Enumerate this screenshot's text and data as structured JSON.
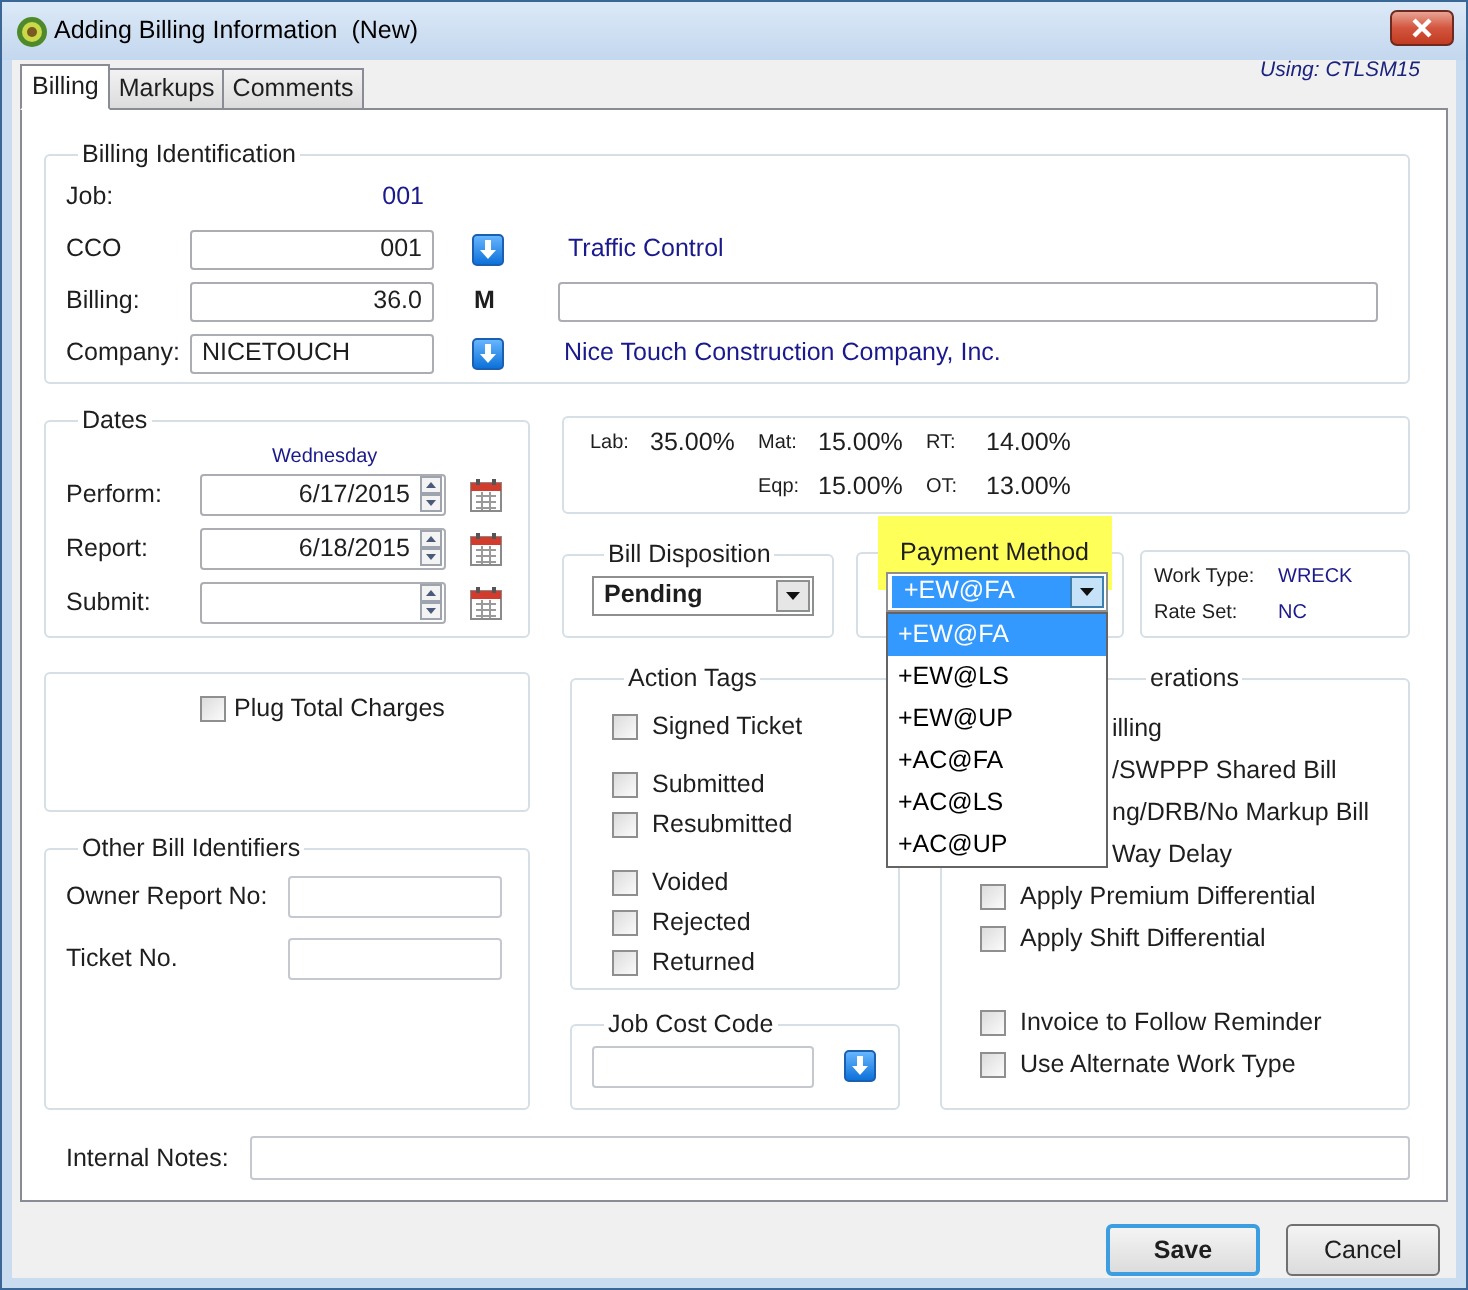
{
  "window": {
    "title": "Adding Billing Information  (New)"
  },
  "tabs": [
    {
      "label": "Billing",
      "selected": true
    },
    {
      "label": "Markups",
      "selected": false
    },
    {
      "label": "Comments",
      "selected": false
    }
  ],
  "using": "Using: CTLSM15",
  "billing_identification": {
    "title": "Billing Identification",
    "job_label": "Job:",
    "job_value": "001",
    "cco_label": "CCO",
    "cco_value": "001",
    "cco_name": "Traffic Control",
    "billing_label": "Billing:",
    "billing_value": "36.0",
    "billing_flag": "M",
    "company_label": "Company:",
    "company_value": "NICETOUCH",
    "company_name": "Nice Touch Construction Company, Inc."
  },
  "dates": {
    "title": "Dates",
    "weekday": "Wednesday",
    "rows": [
      {
        "label": "Perform:",
        "value": "6/17/2015"
      },
      {
        "label": "Report:",
        "value": "6/18/2015"
      },
      {
        "label": "Submit:"
      }
    ]
  },
  "rates": [
    [
      {
        "label": "Lab:",
        "value": "35.00%"
      },
      {
        "label": "Mat:",
        "value": "15.00%"
      },
      {
        "label": "RT:",
        "value": "14.00%"
      }
    ],
    [
      {
        "label": "Eqp:",
        "value": "15.00%"
      },
      {
        "label": "OT:",
        "value": "13.00%"
      }
    ]
  ],
  "bill_disposition": {
    "title": "Bill Disposition",
    "value": "Pending"
  },
  "payment_method": {
    "title": "Payment Method",
    "highlighted": true,
    "value": "+EW@FA",
    "expanded": true,
    "options": [
      {
        "label": "+EW@FA",
        "selected": true
      },
      {
        "label": "+EW@LS",
        "selected": false
      },
      {
        "label": "+EW@UP",
        "selected": false
      },
      {
        "label": "+AC@FA",
        "selected": false
      },
      {
        "label": "+AC@LS",
        "selected": false
      },
      {
        "label": "+AC@UP",
        "selected": false
      }
    ]
  },
  "work_info": [
    {
      "label": "Work Type:",
      "value": "WRECK"
    },
    {
      "label": "Rate Set:",
      "value": "NC"
    }
  ],
  "plug_total_charges": {
    "label": "Plug Total Charges",
    "checked": false
  },
  "other_bill_identifiers": {
    "title": "Other Bill Identifiers",
    "fields": [
      {
        "label": "Owner Report No:"
      },
      {
        "label": "Ticket No."
      }
    ]
  },
  "action_tags": {
    "title": "Action Tags",
    "groups": [
      [
        {
          "label": "Signed Ticket",
          "checked": false
        }
      ],
      [
        {
          "label": "Submitted",
          "checked": false
        },
        {
          "label": "Resubmitted",
          "checked": false
        }
      ],
      [
        {
          "label": "Voided",
          "checked": false
        },
        {
          "label": "Rejected",
          "checked": false
        },
        {
          "label": "Returned",
          "checked": false
        }
      ]
    ]
  },
  "job_cost_code": {
    "title": "Job Cost Code"
  },
  "options_group": {
    "title": "erations",
    "groups": [
      [
        {
          "kind": "covered",
          "label": "illing"
        },
        {
          "kind": "covered",
          "label": "/SWPPP Shared Bill"
        },
        {
          "kind": "covered",
          "label": "ng/DRB/No Markup Bill"
        },
        {
          "kind": "covered",
          "label": "Way Delay"
        },
        {
          "kind": "checkbox",
          "label": "Apply Premium Differential",
          "checked": false
        },
        {
          "kind": "checkbox",
          "label": "Apply Shift Differential",
          "checked": false
        }
      ],
      [
        {
          "kind": "checkbox",
          "label": "Invoice to Follow Reminder",
          "checked": false
        },
        {
          "kind": "checkbox",
          "label": "Use Alternate Work Type",
          "checked": false
        }
      ]
    ]
  },
  "internal_notes": {
    "label": "Internal Notes:"
  },
  "buttons": [
    {
      "label": "Save",
      "default": true
    },
    {
      "label": "Cancel",
      "default": false
    }
  ]
}
